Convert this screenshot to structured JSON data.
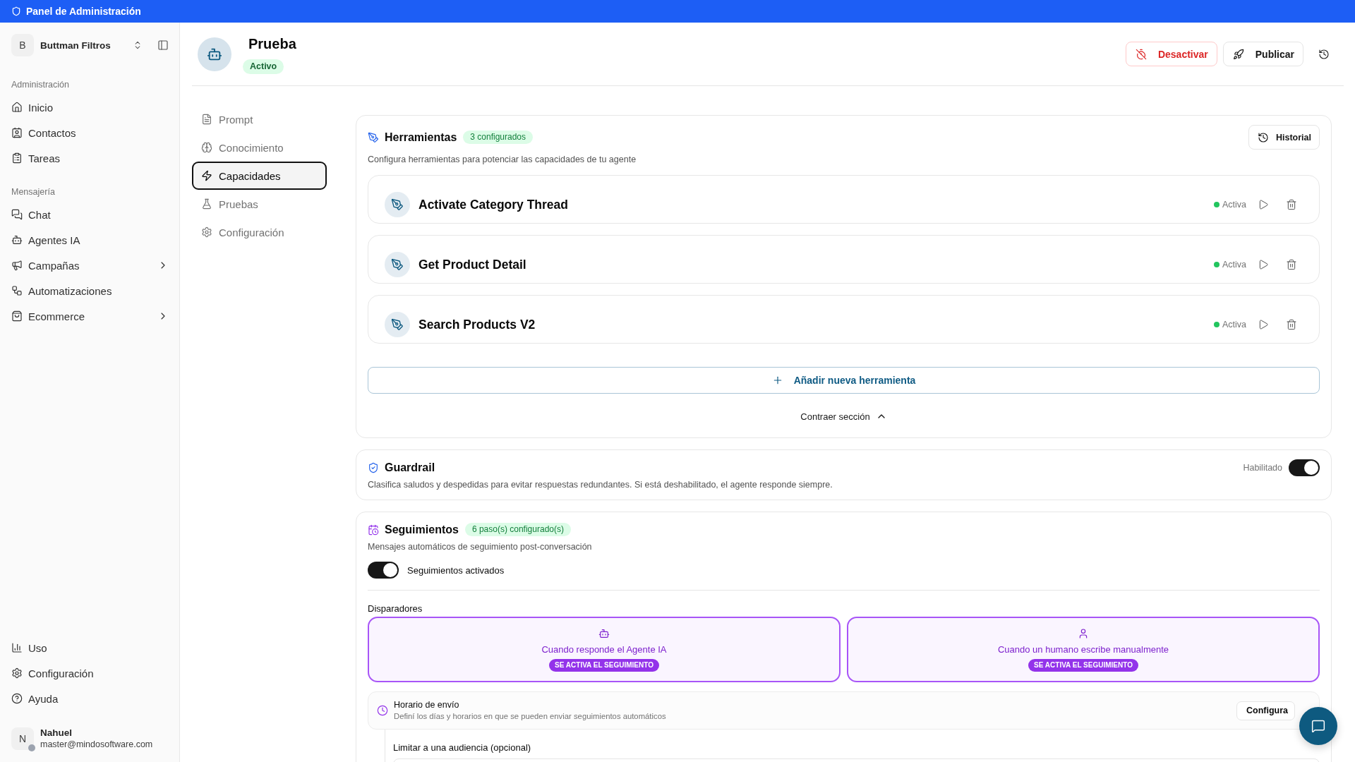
{
  "top_bar": {
    "title": "Panel de Administración"
  },
  "sidebar": {
    "workspace": {
      "initial": "B",
      "name": "Buttman Filtros"
    },
    "sections": [
      {
        "label": "Administración",
        "items": [
          {
            "label": "Inicio",
            "selected": false
          },
          {
            "label": "Contactos",
            "selected": false
          },
          {
            "label": "Tareas",
            "selected": false
          }
        ]
      },
      {
        "label": "Mensajería",
        "items": [
          {
            "label": "Chat",
            "selected": false
          },
          {
            "label": "Agentes IA",
            "selected": false
          },
          {
            "label": "Campañas",
            "selected": false,
            "expanded": false
          },
          {
            "label": "Automatizaciones",
            "selected": false
          },
          {
            "label": "Ecommerce",
            "selected": false,
            "expanded": false
          }
        ]
      }
    ],
    "footer_items": [
      {
        "label": "Uso",
        "selected": false
      },
      {
        "label": "Configuración",
        "selected": false
      },
      {
        "label": "Ayuda",
        "selected": false
      }
    ],
    "user": {
      "initial": "N",
      "name": "Nahuel",
      "email": "master@mindosoftware.com",
      "online": false
    }
  },
  "agent": {
    "name": "Prueba",
    "status": "Activo",
    "actions": [
      {
        "label": "Desactivar",
        "kind": "danger"
      },
      {
        "label": "Publicar",
        "kind": "default"
      }
    ]
  },
  "agent_tabs": [
    {
      "label": "Prompt",
      "selected": false
    },
    {
      "label": "Conocimiento",
      "selected": false
    },
    {
      "label": "Capacidades",
      "selected": true
    },
    {
      "label": "Pruebas",
      "selected": false
    },
    {
      "label": "Configuración",
      "selected": false
    }
  ],
  "tools": {
    "title": "Herramientas",
    "badge": "3 configurados",
    "history_button": "Historial",
    "description": "Configura herramientas para potenciar las capacidades de tu agente",
    "items": [
      {
        "name": "Activate Category Thread",
        "status": "Activa",
        "active": true
      },
      {
        "name": "Get Product Detail",
        "status": "Activa",
        "active": true
      },
      {
        "name": "Search Products V2",
        "status": "Activa",
        "active": true
      }
    ],
    "add_button": "Añadir nueva herramienta",
    "collapse_button": "Contraer sección",
    "expanded": true
  },
  "guardrail": {
    "title": "Guardrail",
    "description": "Clasifica saludos y despedidas para evitar respuestas redundantes. Si está deshabilitado, el agente responde siempre.",
    "toggle": {
      "label": "Habilitado",
      "on": true
    }
  },
  "follow_ups": {
    "title": "Seguimientos",
    "badge": "6 paso(s) configurado(s)",
    "description": "Mensajes automáticos de seguimiento post-conversación",
    "toggle": {
      "label": "Seguimientos activados",
      "on": true
    },
    "triggers_label": "Disparadores",
    "triggers": [
      {
        "label": "Cuando responde el Agente IA",
        "tag": "SE ACTIVA EL SEGUIMIENTO",
        "selected": true
      },
      {
        "label": "Cuando un humano escribe manualmente",
        "tag": "SE ACTIVA EL SEGUIMIENTO",
        "selected": true
      }
    ],
    "schedule": {
      "title": "Horario de envío",
      "description": "Definí los días y horarios en que se pueden enviar seguimientos automáticos",
      "button": "Configura"
    },
    "audience": {
      "label": "Limitar a una audiencia (opcional)"
    }
  }
}
